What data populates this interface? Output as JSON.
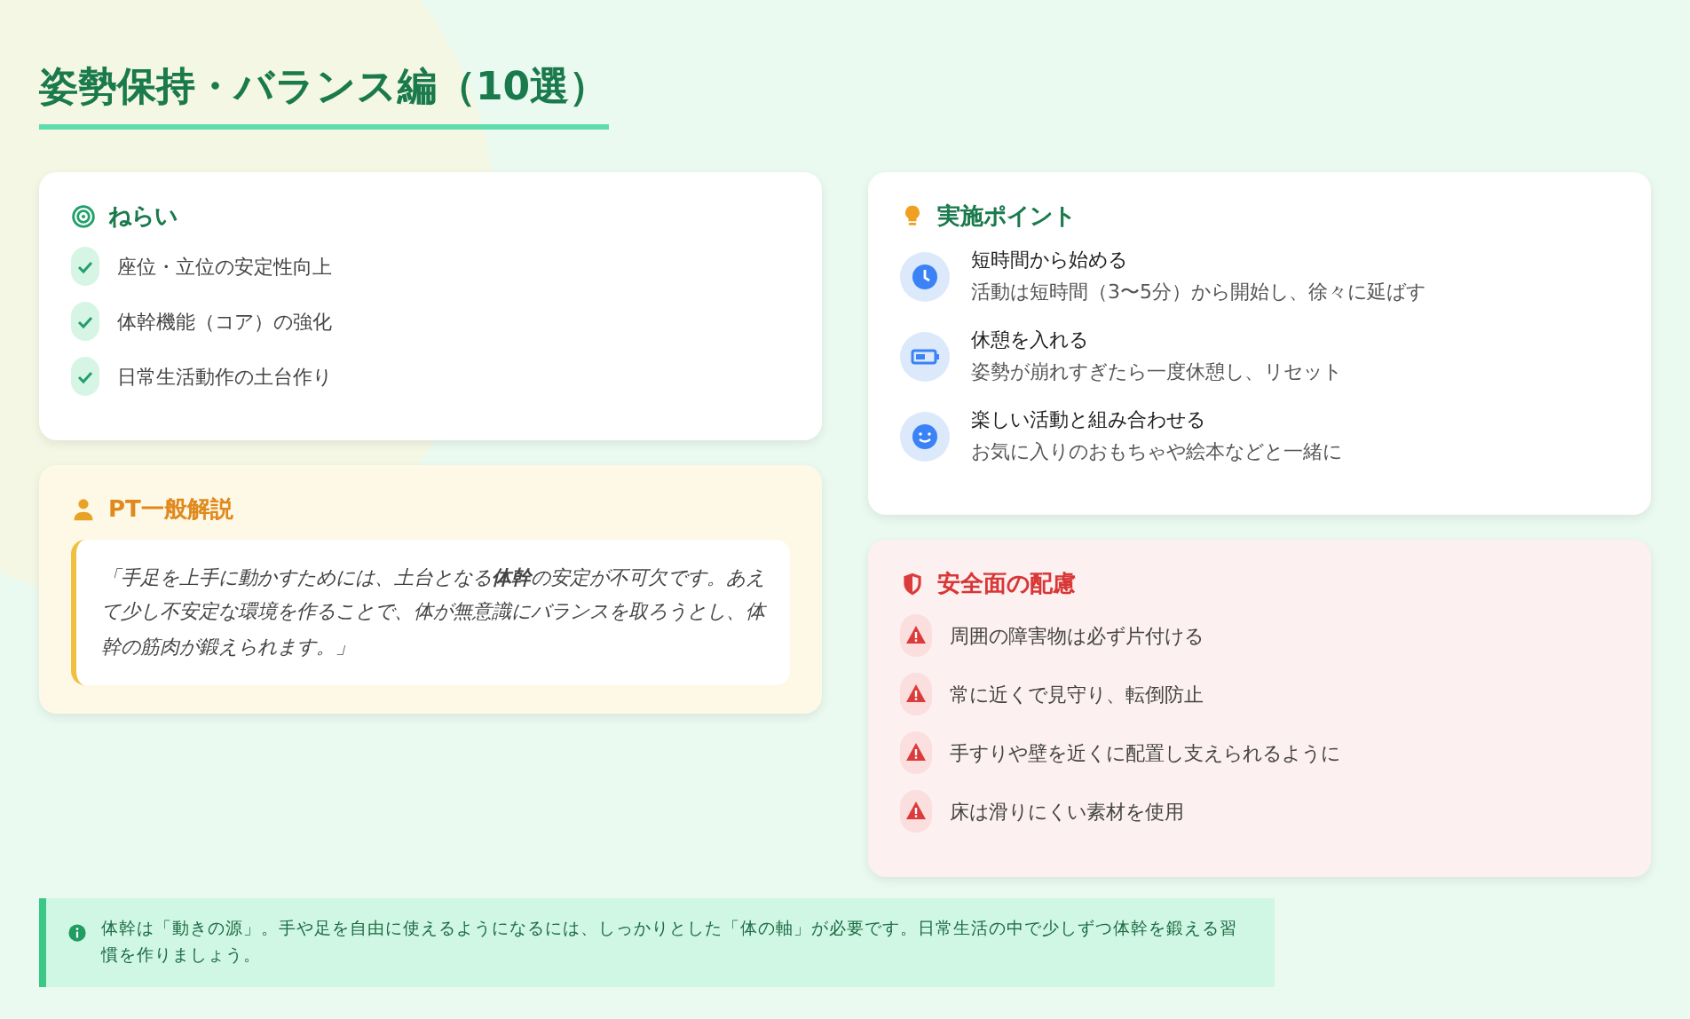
{
  "title": "姿勢保持・バランス編（10選）",
  "aims": {
    "heading": "ねらい",
    "items": [
      "座位・立位の安定性向上",
      "体幹機能（コア）の強化",
      "日常生活動作の土台作り"
    ]
  },
  "pt": {
    "heading": "PT一般解説",
    "quote": "「手足を上手に動かすためには、土台となる**体幹**の安定が不可欠です。あえて少し不安定な環境を作ることで、体が無意識にバランスを取ろうとし、体幹の筋肉が鍛えられます。」"
  },
  "points": {
    "heading": "実施ポイント",
    "items": [
      {
        "kind": "clock",
        "title": "短時間から始める",
        "text": "活動は短時間（3〜5分）から開始し、徐々に延ばす"
      },
      {
        "kind": "battery",
        "title": "休憩を入れる",
        "text": "姿勢が崩れすぎたら一度休憩し、リセット"
      },
      {
        "kind": "smile",
        "title": "楽しい活動と組み合わせる",
        "text": "お気に入りのおもちゃや絵本などと一緒に"
      }
    ]
  },
  "safety": {
    "heading": "安全面の配慮",
    "items": [
      "周囲の障害物は必ず片付ける",
      "常に近くで見守り、転倒防止",
      "手すりや壁を近くに配置し支えられるように",
      "床は滑りにくい素材を使用"
    ]
  },
  "note": "体幹は「動きの源」。手や足を自由に使えるようになるには、しっかりとした「体の軸」が必要です。日常生活の中で少しずつ体幹を鍛える習慣を作りましょう。"
}
